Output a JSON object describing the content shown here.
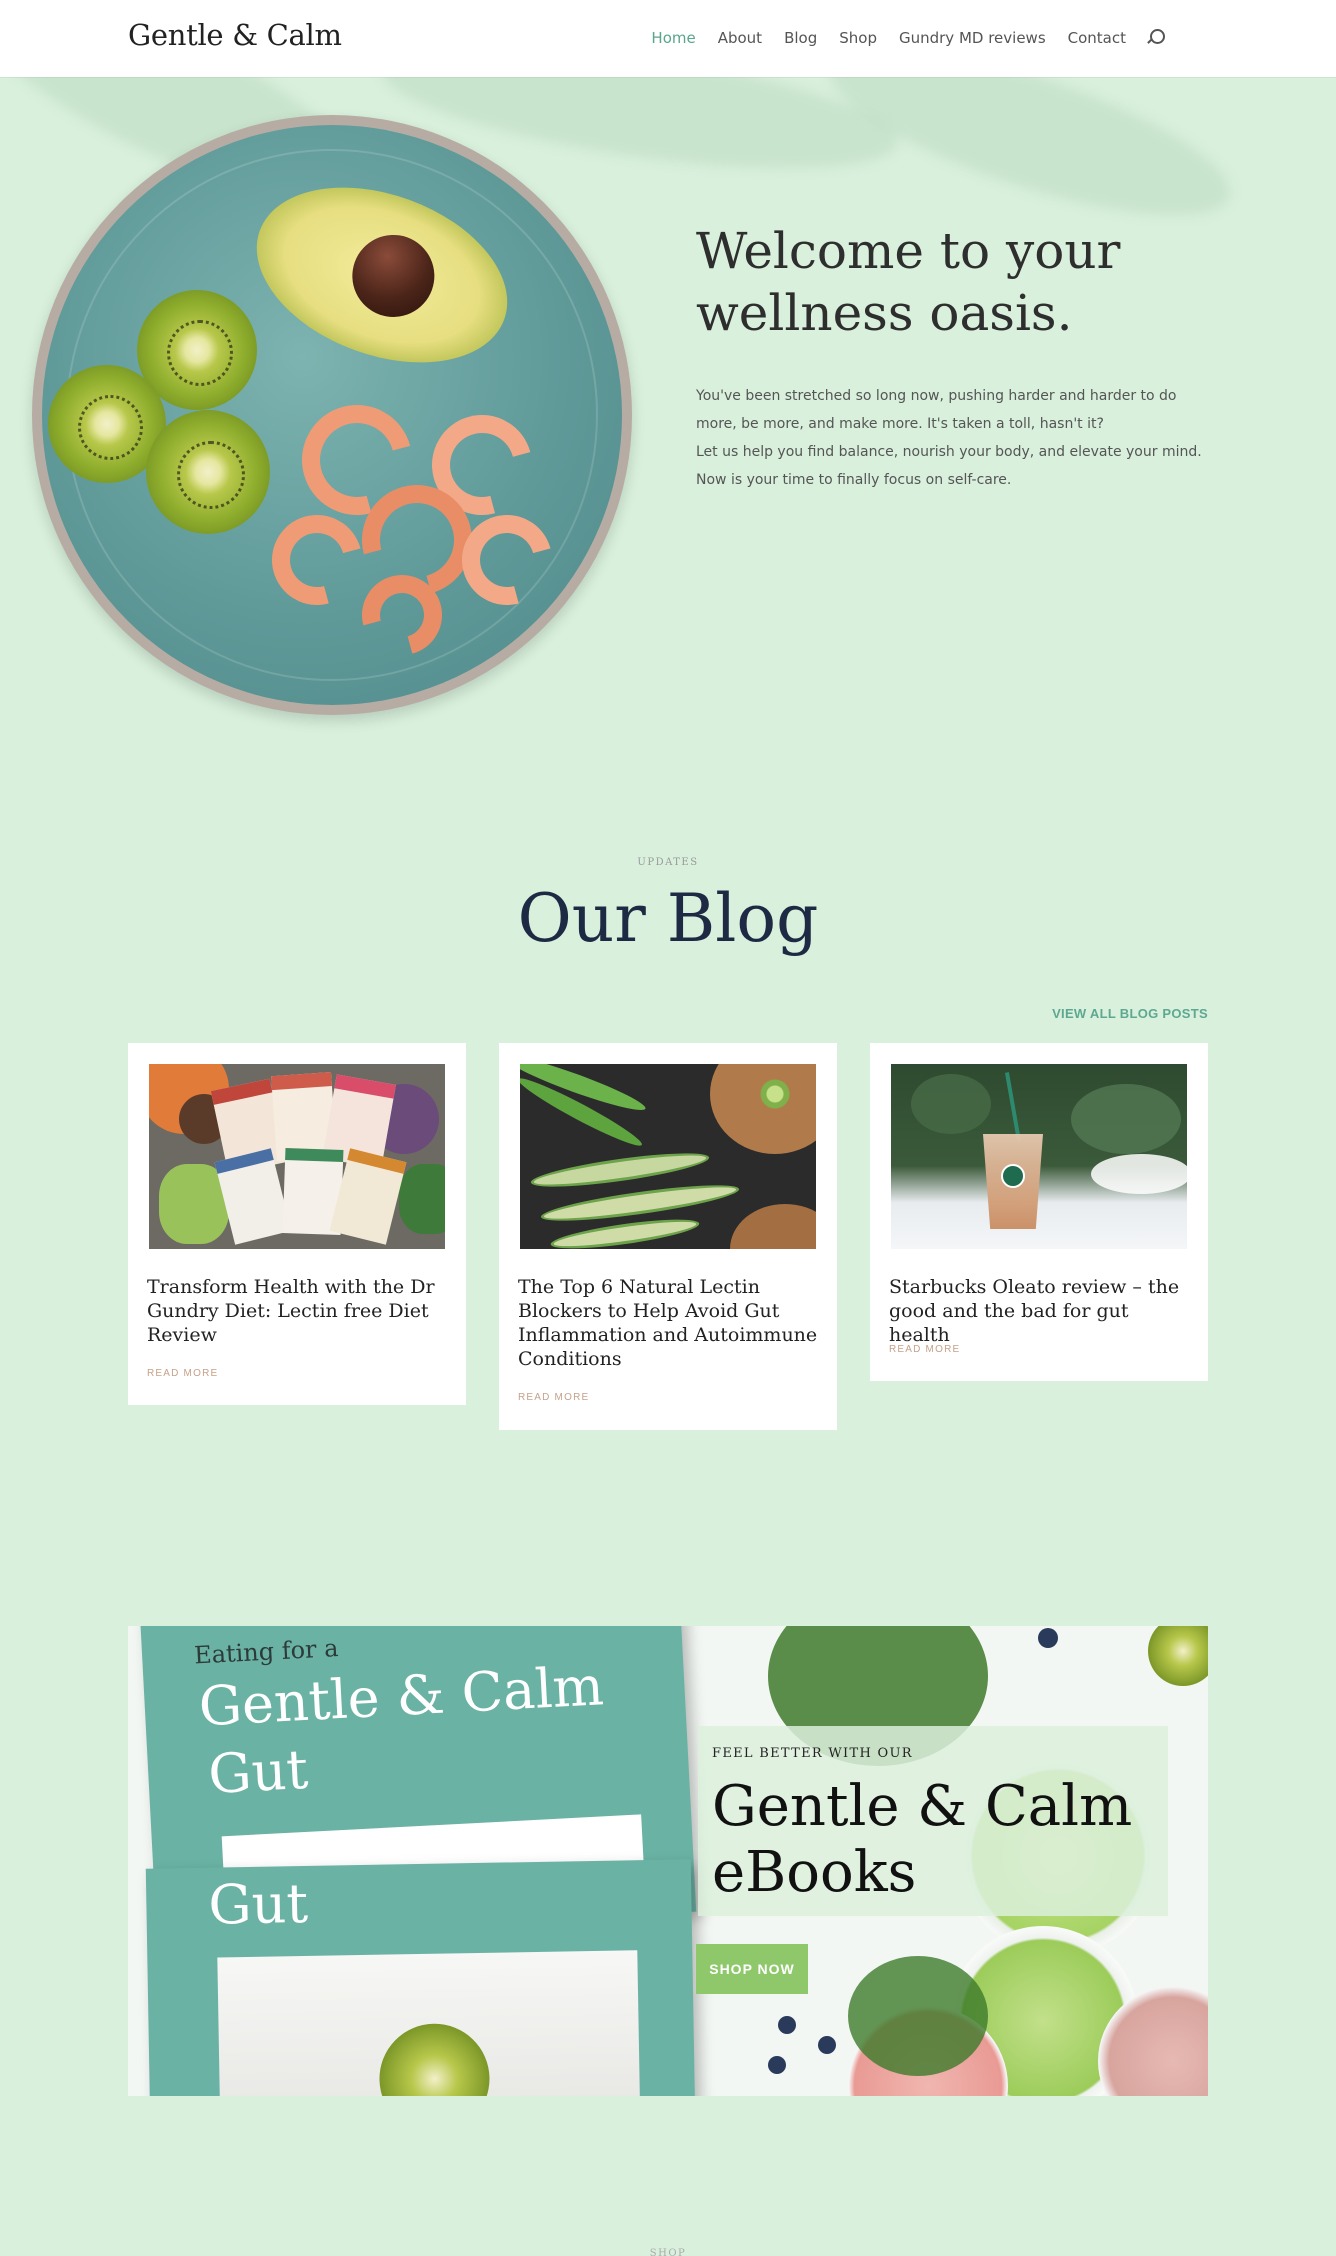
{
  "header": {
    "logo": "Gentle & Calm",
    "nav": [
      "Home",
      "About",
      "Blog",
      "Shop",
      "Gundry MD reviews",
      "Contact"
    ],
    "active_nav": "Home"
  },
  "hero": {
    "title": "Welcome to your wellness oasis.",
    "body_1": "You've been stretched so long now, pushing harder and harder to do more, be more, and make more. It's taken a toll, hasn't it?",
    "body_2": "Let us help you find balance, nourish your body, and elevate your mind. Now is your time to finally focus on self-care."
  },
  "blog": {
    "kicker": "UPDATES",
    "title": "Our Blog",
    "view_all": "VIEW ALL BLOG POSTS",
    "posts": [
      {
        "title": "Transform Health with the Dr Gundry Diet: Lectin free Diet Review",
        "more": "READ MORE"
      },
      {
        "title": "The Top 6 Natural Lectin Blockers to Help Avoid Gut Inflammation and Autoimmune Conditions",
        "more": "READ MORE"
      },
      {
        "title": "Starbucks Oleato review – the good and the bad for gut health",
        "more": "READ MORE"
      }
    ]
  },
  "promo": {
    "book_text_1": "Eating for a",
    "book_text_2": "Gentle & Calm",
    "book_text_3": "Gut",
    "book_text_4": "Gut",
    "kicker": "FEEL BETTER WITH OUR",
    "title": "Gentle & Calm eBooks",
    "button": "SHOP NOW"
  },
  "shop_kicker": "SHOP",
  "colors": {
    "background": "#d8f0dc",
    "accent": "#59a58e",
    "title_navy": "#1e2a44",
    "button_green": "#8ec86b",
    "book_teal": "#6ab3a4"
  }
}
